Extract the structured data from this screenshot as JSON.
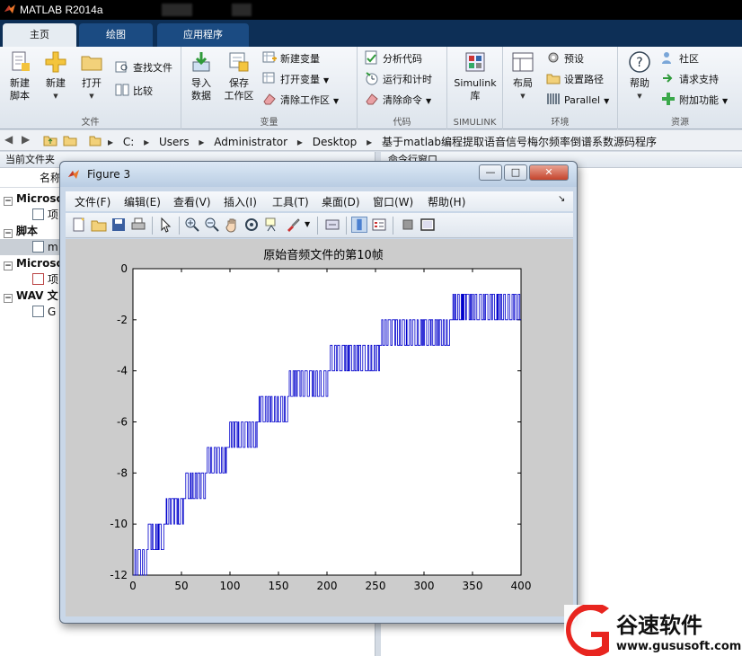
{
  "app": {
    "title": "MATLAB R2014a"
  },
  "tabs": [
    {
      "label": "主页"
    },
    {
      "label": "绘图"
    },
    {
      "label": "应用程序"
    }
  ],
  "ribbon": {
    "groups": {
      "file": {
        "label": "文件",
        "new_script": "新建\n脚本",
        "new": "新建",
        "open": "打开",
        "find_files": "查找文件",
        "compare": "比较"
      },
      "variable": {
        "label": "变量",
        "import_data": "导入\n数据",
        "save_workspace": "保存\n工作区",
        "new_variable": "新建变量",
        "open_variable": "打开变量",
        "clear_workspace": "清除工作区"
      },
      "code": {
        "label": "代码",
        "analyze_code": "分析代码",
        "run_and_time": "运行和计时",
        "clear_commands": "清除命令"
      },
      "simulink": {
        "label": "SIMULINK",
        "simulink_library": "Simulink\n库"
      },
      "environment": {
        "label": "环境",
        "layout": "布局",
        "preferences": "预设",
        "set_path": "设置路径",
        "parallel": "Parallel"
      },
      "resources": {
        "label": "资源",
        "help": "帮助",
        "community": "社区",
        "request_support": "请求支持",
        "add_ons": "附加功能"
      }
    }
  },
  "address": {
    "crumbs": [
      "C:",
      "Users",
      "Administrator",
      "Desktop",
      "基于matlab编程提取语音信号梅尔频率倒谱系数源码程序"
    ]
  },
  "current_folder": {
    "header": "当前文件夹",
    "column_name": "名称",
    "rows": [
      {
        "kind": "group",
        "label": "Microso"
      },
      {
        "kind": "file",
        "label": "项"
      },
      {
        "kind": "group",
        "label": "脚本"
      },
      {
        "kind": "file",
        "label": "m"
      },
      {
        "kind": "group",
        "label": "Microso"
      },
      {
        "kind": "file",
        "label": "项"
      },
      {
        "kind": "group",
        "label": "WAV 文"
      },
      {
        "kind": "file",
        "label": "G"
      }
    ]
  },
  "command_window": {
    "header": "命令行窗口"
  },
  "figure": {
    "title": "Figure 3",
    "menu": [
      "文件(F)",
      "编辑(E)",
      "查看(V)",
      "插入(I)",
      "工具(T)",
      "桌面(D)",
      "窗口(W)",
      "帮助(H)"
    ],
    "toolbar_icons": [
      "new-figure-icon",
      "open-icon",
      "save-icon",
      "print-icon",
      "pointer-icon",
      "zoom-in-icon",
      "zoom-out-icon",
      "pan-icon",
      "rotate-icon",
      "data-cursor-icon",
      "brush-icon",
      "link-icon",
      "colorbar-icon",
      "legend-icon",
      "hide-tools-icon",
      "show-tools-icon"
    ]
  },
  "chart_data": {
    "type": "line",
    "title": "原始音频文件的第10帧",
    "xlabel": "",
    "ylabel": "",
    "xlim": [
      0,
      400
    ],
    "ylim": [
      -12,
      0
    ],
    "xticks": [
      0,
      50,
      100,
      150,
      200,
      250,
      300,
      350,
      400
    ],
    "yticks": [
      0,
      -2,
      -4,
      -6,
      -8,
      -10,
      -12
    ],
    "grid": false,
    "series": [
      {
        "color": "#0000cc",
        "segments": [
          {
            "x_start": 0,
            "x_end": 15,
            "low": -12,
            "high": -11
          },
          {
            "x_start": 15,
            "x_end": 32,
            "low": -11,
            "high": -10
          },
          {
            "x_start": 32,
            "x_end": 52,
            "low": -10,
            "high": -9
          },
          {
            "x_start": 52,
            "x_end": 75,
            "low": -9,
            "high": -8
          },
          {
            "x_start": 75,
            "x_end": 98,
            "low": -8,
            "high": -7
          },
          {
            "x_start": 98,
            "x_end": 128,
            "low": -7,
            "high": -6
          },
          {
            "x_start": 128,
            "x_end": 160,
            "low": -6,
            "high": -5
          },
          {
            "x_start": 160,
            "x_end": 202,
            "low": -5,
            "high": -4
          },
          {
            "x_start": 202,
            "x_end": 255,
            "low": -4,
            "high": -3
          },
          {
            "x_start": 255,
            "x_end": 327,
            "low": -3,
            "high": -2
          },
          {
            "x_start": 327,
            "x_end": 400,
            "low": -2,
            "high": -1
          }
        ]
      }
    ]
  },
  "watermark": {
    "brand": "谷速软件",
    "url": "www.gususoft.com"
  },
  "colors": {
    "titlebar": "#000000",
    "tabstrip": "#0d2f56",
    "plot_line": "#0000cc",
    "watermark_red": "#e8251f"
  }
}
